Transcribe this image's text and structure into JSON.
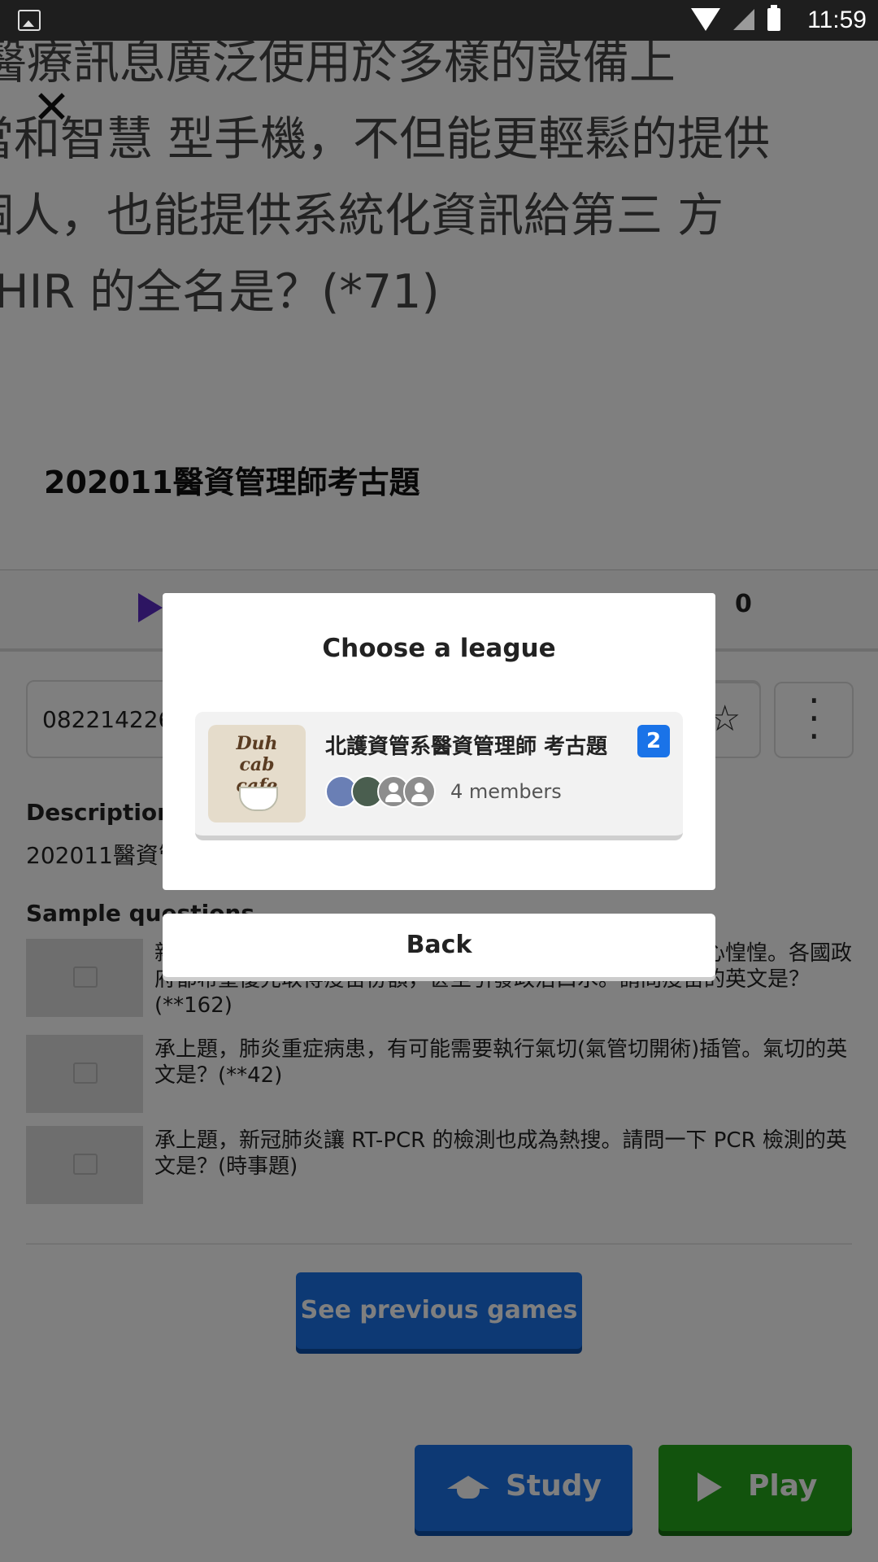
{
  "status_bar": {
    "time": "11:59"
  },
  "question_text": {
    "line1": "l醫療訊息廣泛使用於多樣的設備上",
    "line2": "當和智慧 型手機，不但能更輕鬆的提供",
    "line3": "個人，也能提供系統化資訊給第三 方",
    "line4": "FHIR 的全名是？(*71)"
  },
  "quiz": {
    "title": "202011醫資管理師考古題",
    "star_count": "0",
    "code": "082214226",
    "description_label": "Description",
    "description_text": "202011醫資管",
    "sample_label": "Sample questions",
    "sample_questions": [
      {
        "text": "新冠肺炎疫情延燒，全球確診人數屢創歷年新高，讓民眾人心惶惶。各國政府都希望優先取得疫苗份額，甚至引發政治口水。請問疫苗的英文是？(**162)"
      },
      {
        "text": "承上題，肺炎重症病患，有可能需要執行氣切(氣管切開術)插管。氣切的英文是？(**42)"
      },
      {
        "text": "承上題，新冠肺炎讓 RT-PCR 的檢測也成為熱搜。請問一下 PCR 檢測的英文是？(時事題)"
      }
    ],
    "previous_games_label": "See previous games",
    "study_label": "Study",
    "play_label": "Play"
  },
  "dialog": {
    "title": "Choose a league",
    "league": {
      "image_text": "Duh cab cafe",
      "name": "北護資管系醫資管理師 考古題",
      "badge": "2",
      "members": "4 members"
    },
    "back_label": "Back"
  }
}
